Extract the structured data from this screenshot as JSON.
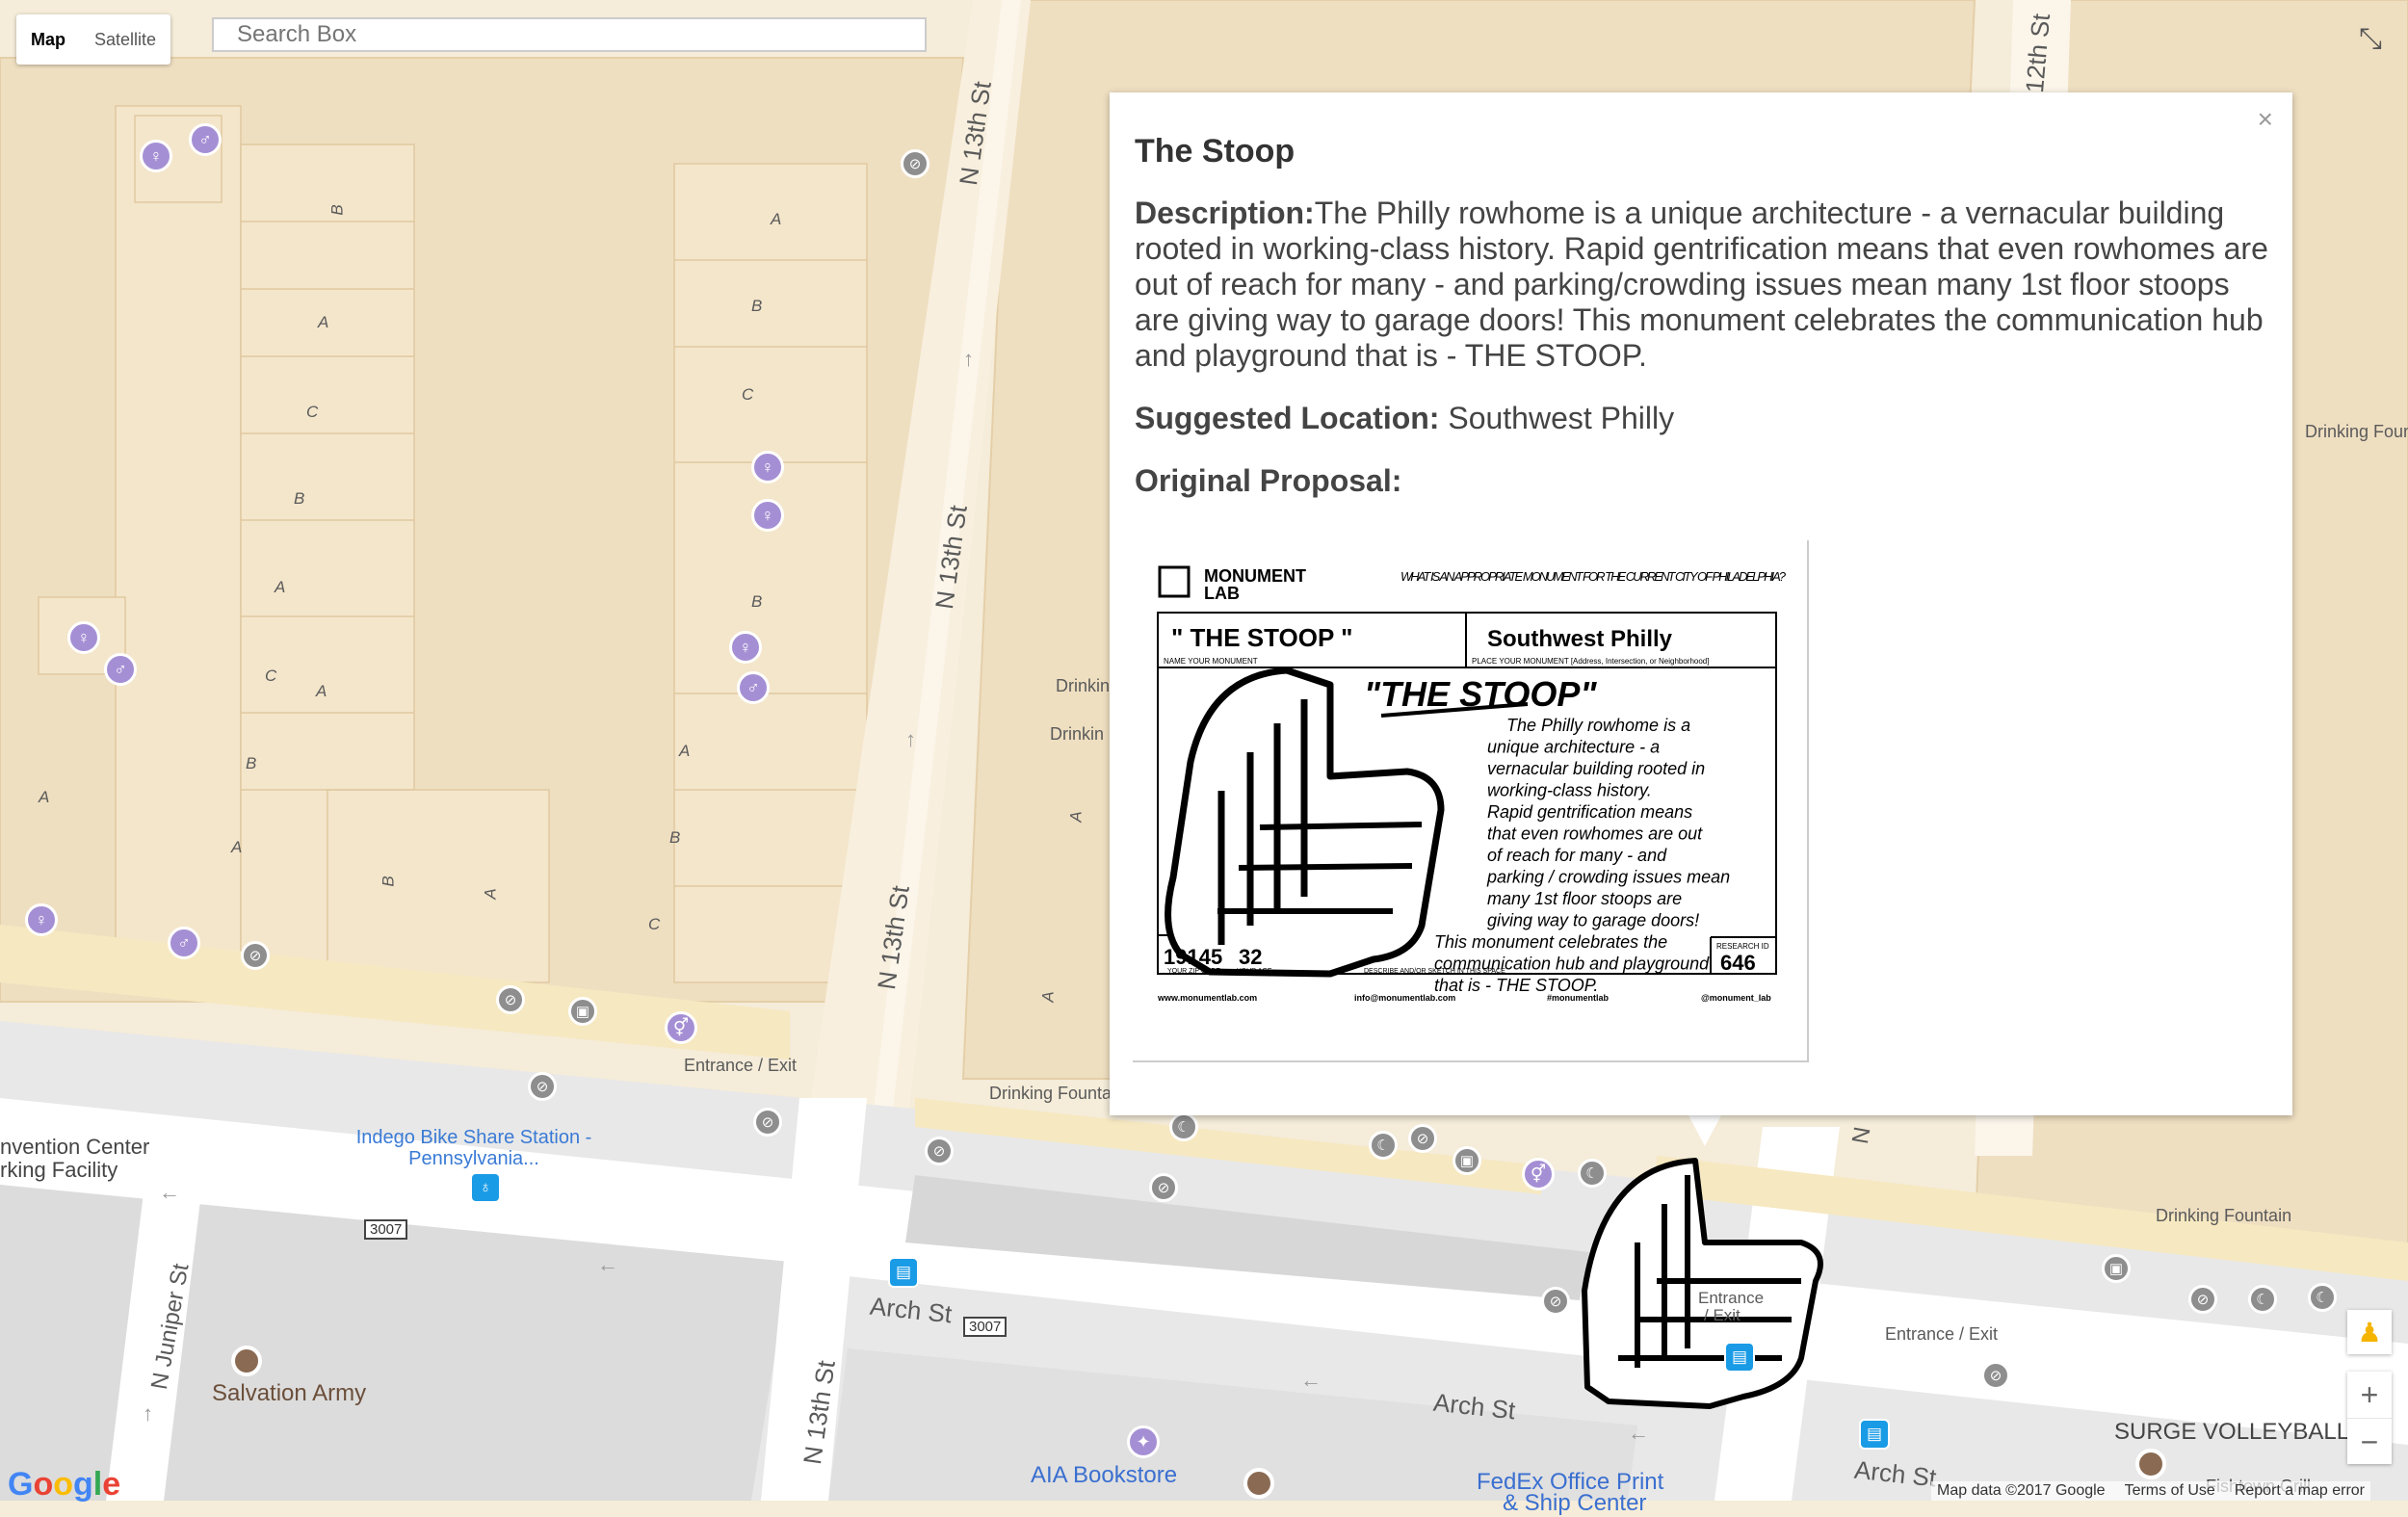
{
  "map_type": {
    "map_label": "Map",
    "satellite_label": "Satellite",
    "selected": "Map"
  },
  "search": {
    "placeholder": "Search Box",
    "value": ""
  },
  "info_window": {
    "title": "The Stoop",
    "description_label": "Description:",
    "description": "The Philly rowhome is a unique architecture - a vernacular building rooted in working-class history. Rapid gentrification means that even rowhomes are out of reach for many - and parking/crowding issues mean many 1st floor stoops are giving way to garage doors! This monument celebrates the communication hub and playground that is - THE STOOP.",
    "location_label": "Suggested Location:",
    "location": "Southwest Philly",
    "proposal_label": "Original Proposal:",
    "close_label": "×"
  },
  "proposal_card": {
    "brand": "MONUMENT",
    "brand2": "LAB",
    "question": "WHAT IS AN APPROPRIATE MONUMENT FOR THE CURRENT CITY OF PHILADELPHIA?",
    "monument_name": "\" THE STOOP \"",
    "name_caption": "NAME YOUR MONUMENT",
    "place": "Southwest Philly",
    "place_caption": "PLACE YOUR MONUMENT [Address, Intersection, or Neighborhood]",
    "heading": "\"THE STOOP\"",
    "text_lines": [
      "The Philly rowhome is a",
      "unique architecture - a",
      "vernacular building rooted in",
      "working-class history.",
      "Rapid gentrification means",
      "that even rowhomes are out",
      "of reach for many - and",
      "parking / crowding issues mean",
      "many 1st floor stoops are",
      "giving way to garage doors!",
      "This monument celebrates the",
      "communication hub and playground",
      "that is - THE STOOP."
    ],
    "zip": "19145",
    "zip_caption": "YOUR ZIP CODE",
    "age": "32",
    "age_caption": "YOUR AGE",
    "sketch_caption": "DESCRIBE AND/OR SKETCH IN THIS SPACE",
    "research_caption": "RESEARCH ID",
    "research_id": "646",
    "footer": [
      "www.monumentlab.com",
      "info@monumentlab.com",
      "#monumentlab",
      "@monument_lab"
    ]
  },
  "map_labels": {
    "streets": [
      "N 13th St",
      "N 13th St",
      "N 13th St",
      "N 13th St",
      "12th St",
      "Arch St",
      "Arch St",
      "Arch St",
      "N Juniper St",
      "N"
    ],
    "route_shields": [
      "3007",
      "3007"
    ],
    "places": [
      "Indego Bike Share Station - Pennsylvania...",
      "nvention Center",
      "rking Facility",
      "Salvation Army",
      "AIA Bookstore",
      "FedEx Office Print",
      "& Ship Center",
      "SURGE VOLLEYBALL",
      "Drinking Fountain",
      "Drinking Fountain",
      "Drinking Foun",
      "Drinkin",
      "Drinkin",
      "Entrance / Exit",
      "Entrance / Exit",
      "Entrance",
      "/ Exit",
      "Fishtown Grill"
    ],
    "units": [
      "A",
      "B",
      "C",
      "A",
      "B",
      "C",
      "A",
      "B",
      "C",
      "A",
      "B",
      "A",
      "B",
      "A",
      "B",
      "C",
      "B",
      "A",
      "A",
      "A",
      "A"
    ]
  },
  "controls": {
    "zoom_in": "+",
    "zoom_out": "−",
    "fullscreen_icon": "⤡",
    "pegman_icon": "♟"
  },
  "attribution": {
    "map_data": "Map data ©2017 Google",
    "terms": "Terms of Use",
    "report": "Report a map error"
  },
  "logo": {
    "text": "Google",
    "colors": [
      "#4285F4",
      "#EA4335",
      "#FBBC05",
      "#4285F4",
      "#34A853",
      "#EA4335"
    ]
  },
  "colors": {
    "road": "#ffffff",
    "building": "#f3e3c4",
    "block": "#ecd9b8",
    "poi_purple": "#a58fd4",
    "transit_blue": "#1a9be6"
  }
}
